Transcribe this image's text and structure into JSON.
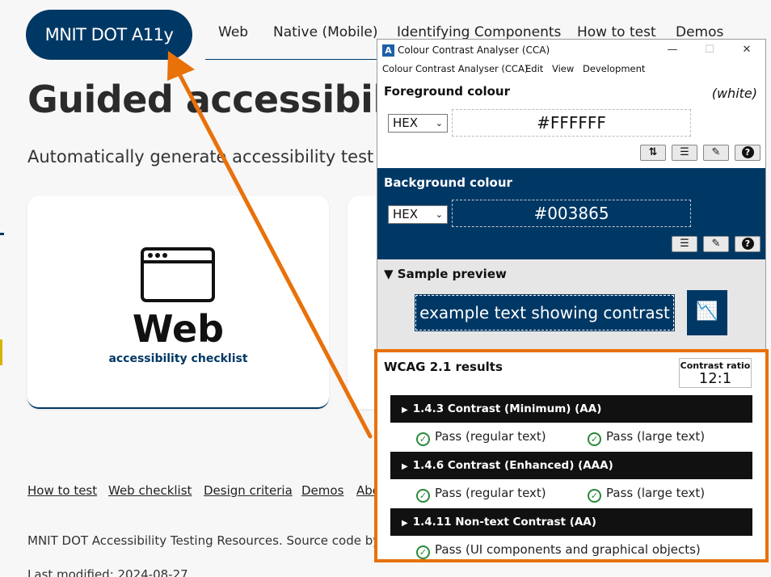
{
  "site": {
    "logo": "MNIT DOT A11y",
    "nav": [
      "Web",
      "Native (Mobile)",
      "Identifying Components",
      "How to test",
      "Demos"
    ],
    "hero_title": "Guided accessibility",
    "hero_subtitle": "Automatically generate accessibility test",
    "web_card": {
      "title": "Web",
      "subtitle": "accessibility checklist",
      "icon": "browser-window-icon"
    },
    "footer_links": [
      "How to test",
      "Web checklist",
      "Design criteria",
      "Demos",
      "Abo"
    ],
    "footer_text": "MNIT DOT Accessibility Testing Resources. Source code by the",
    "last_modified": "Last modified: 2024-08-27",
    "brand_color": "#003865"
  },
  "cca": {
    "window_title": "Colour Contrast Analyser (CCA)",
    "window_controls": [
      "—",
      "☐",
      "✕"
    ],
    "menu": [
      "Colour Contrast Analyser (CCA)",
      "Edit",
      "View",
      "Development"
    ],
    "foreground": {
      "heading": "Foreground colour",
      "color_name": "(white)",
      "format": "HEX",
      "value": "#FFFFFF",
      "tools": [
        "swap-icon",
        "sliders-icon",
        "eyedropper-icon",
        "help-icon"
      ]
    },
    "background": {
      "heading": "Background colour",
      "format": "HEX",
      "value": "#003865",
      "tools": [
        "sliders-icon",
        "eyedropper-icon",
        "help-icon"
      ]
    },
    "preview": {
      "heading": "Sample preview",
      "sample_text": "example text showing contrast",
      "graphic_icon": "chart-icon"
    },
    "results": {
      "heading": "WCAG 2.1 results",
      "ratio_label": "Contrast ratio",
      "ratio_value": "12:1",
      "criteria": [
        {
          "title": "1.4.3 Contrast (Minimum) (AA)",
          "passes": [
            "Pass (regular text)",
            "Pass (large text)"
          ]
        },
        {
          "title": "1.4.6 Contrast (Enhanced) (AAA)",
          "passes": [
            "Pass (regular text)",
            "Pass (large text)"
          ]
        },
        {
          "title": "1.4.11 Non-text Contrast (AA)",
          "passes": [
            "Pass (UI components and graphical objects)"
          ]
        }
      ]
    }
  },
  "annotation": {
    "color": "#e8710a"
  }
}
